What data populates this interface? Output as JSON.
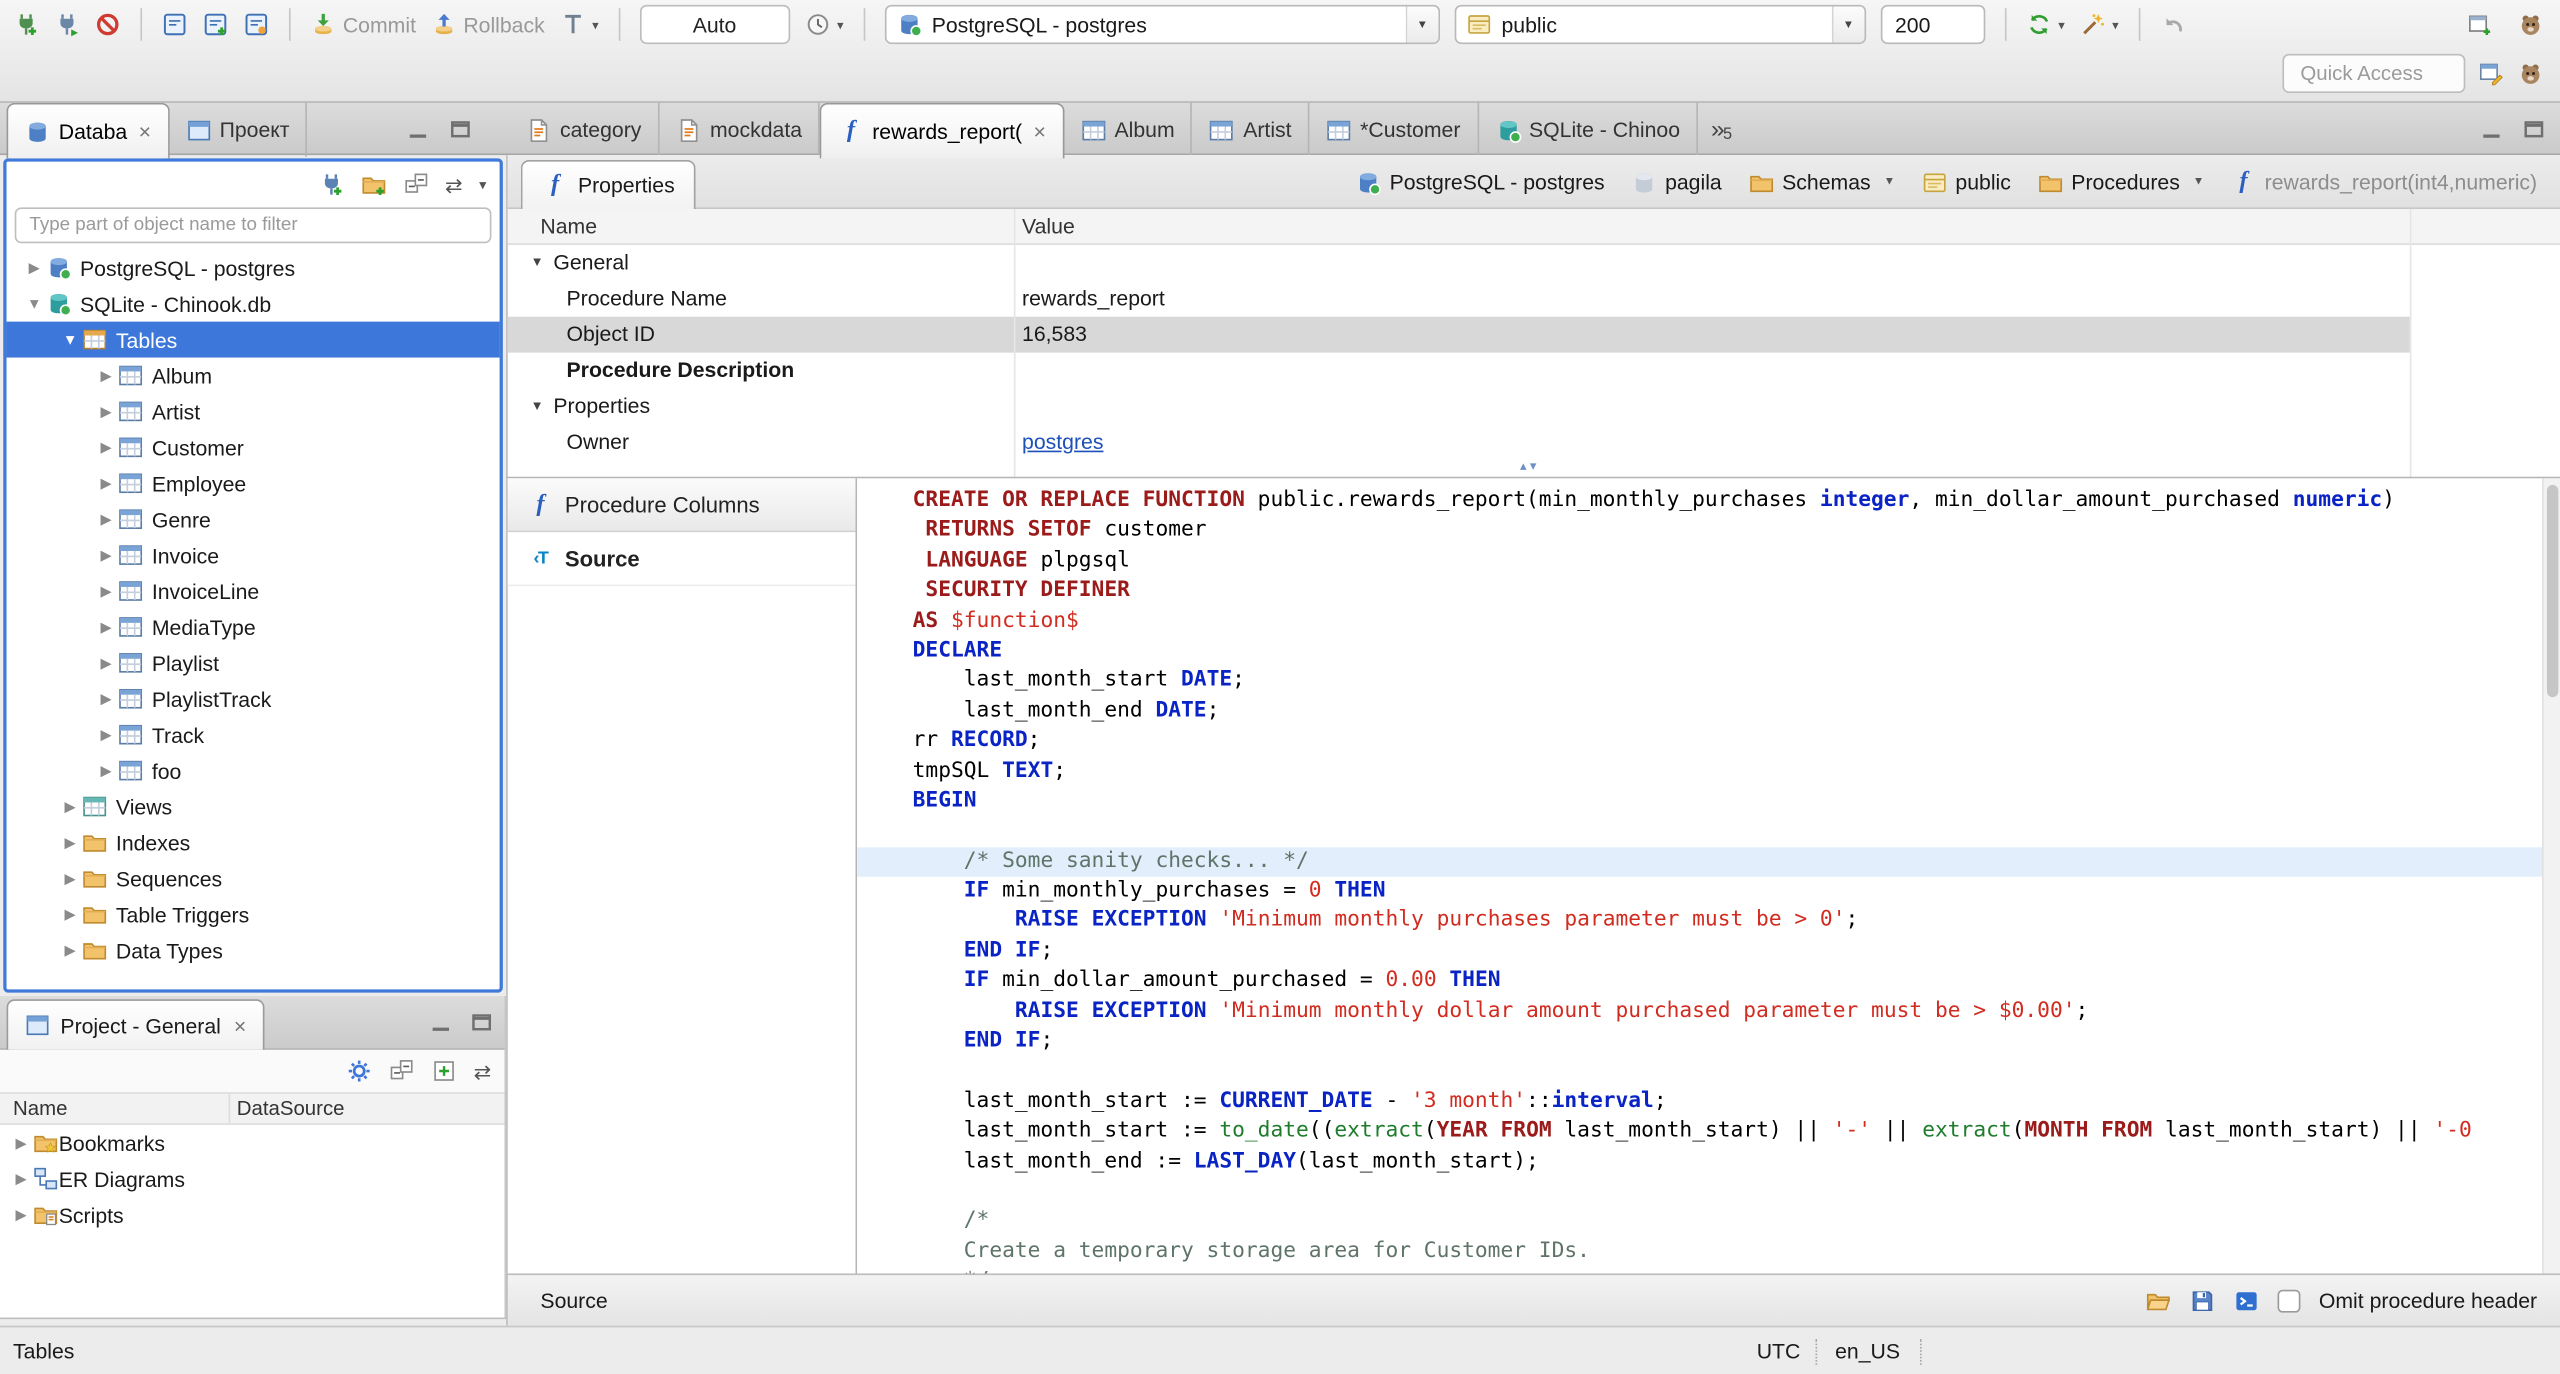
{
  "toolbar": {
    "commit": "Commit",
    "rollback": "Rollback",
    "auto_commit": "Auto",
    "connection": "PostgreSQL - postgres",
    "schema": "public",
    "fetch_size": "200",
    "quick_access": "Quick Access"
  },
  "sidebar": {
    "tabs": [
      {
        "label": "Databa",
        "icon": "db-navigator",
        "closable": true,
        "active": true
      },
      {
        "label": "Проект",
        "icon": "project-view"
      }
    ],
    "filter_placeholder": "Type part of object name to filter",
    "tree": [
      {
        "label": "PostgreSQL - postgres",
        "level": 0,
        "arrow": "right",
        "icon": "db-pg"
      },
      {
        "label": "SQLite - Chinook.db",
        "level": 0,
        "arrow": "down",
        "icon": "db-sqlite"
      },
      {
        "label": "Tables",
        "level": 1,
        "arrow": "down",
        "icon": "tables",
        "selected": true
      },
      {
        "label": "Album",
        "level": 2,
        "arrow": "right",
        "icon": "table"
      },
      {
        "label": "Artist",
        "level": 2,
        "arrow": "right",
        "icon": "table"
      },
      {
        "label": "Customer",
        "level": 2,
        "arrow": "right",
        "icon": "table"
      },
      {
        "label": "Employee",
        "level": 2,
        "arrow": "right",
        "icon": "table"
      },
      {
        "label": "Genre",
        "level": 2,
        "arrow": "right",
        "icon": "table"
      },
      {
        "label": "Invoice",
        "level": 2,
        "arrow": "right",
        "icon": "table"
      },
      {
        "label": "InvoiceLine",
        "level": 2,
        "arrow": "right",
        "icon": "table"
      },
      {
        "label": "MediaType",
        "level": 2,
        "arrow": "right",
        "icon": "table"
      },
      {
        "label": "Playlist",
        "level": 2,
        "arrow": "right",
        "icon": "table"
      },
      {
        "label": "PlaylistTrack",
        "level": 2,
        "arrow": "right",
        "icon": "table"
      },
      {
        "label": "Track",
        "level": 2,
        "arrow": "right",
        "icon": "table"
      },
      {
        "label": "foo",
        "level": 2,
        "arrow": "right",
        "icon": "table"
      },
      {
        "label": "Views",
        "level": 1,
        "arrow": "right",
        "icon": "views"
      },
      {
        "label": "Indexes",
        "level": 1,
        "arrow": "right",
        "icon": "folder"
      },
      {
        "label": "Sequences",
        "level": 1,
        "arrow": "right",
        "icon": "folder"
      },
      {
        "label": "Table Triggers",
        "level": 1,
        "arrow": "right",
        "icon": "folder"
      },
      {
        "label": "Data Types",
        "level": 1,
        "arrow": "right",
        "icon": "folder"
      }
    ]
  },
  "project": {
    "title": "Project - General",
    "columns": [
      "Name",
      "DataSource"
    ],
    "rows": [
      {
        "label": "Bookmarks",
        "icon": "bookmarks"
      },
      {
        "label": "ER Diagrams",
        "icon": "erd"
      },
      {
        "label": "Scripts",
        "icon": "scripts"
      }
    ]
  },
  "editor": {
    "tabs": [
      {
        "label": "category",
        "icon": "sql-script"
      },
      {
        "label": "mockdata",
        "icon": "sql-script"
      },
      {
        "label": "rewards_report(",
        "icon": "function",
        "active": true,
        "closable": true
      },
      {
        "label": "Album",
        "icon": "table"
      },
      {
        "label": "Artist",
        "icon": "table"
      },
      {
        "label": "*Customer",
        "icon": "table"
      },
      {
        "label": "SQLite - Chinoo",
        "icon": "db-sqlite"
      }
    ],
    "hidden_tabs_count": "5",
    "properties_tab": "Properties",
    "breadcrumb": [
      {
        "label": "PostgreSQL - postgres",
        "icon": "db-pg"
      },
      {
        "label": "pagila",
        "icon": "db-gray"
      },
      {
        "label": "Schemas",
        "icon": "folder",
        "caret": true
      },
      {
        "label": "public",
        "icon": "schema"
      },
      {
        "label": "Procedures",
        "icon": "folder",
        "caret": true
      },
      {
        "label": "rewards_report(int4,numeric)",
        "icon": "function",
        "dim": true
      }
    ],
    "grid": {
      "columns": [
        "Name",
        "Value"
      ],
      "rows": [
        {
          "name": "General",
          "group": true
        },
        {
          "name": "Procedure Name",
          "value": "rewards_report"
        },
        {
          "name": "Object ID",
          "value": "16,583",
          "selected": true
        },
        {
          "name": "Procedure Description",
          "bold": true,
          "value": ""
        },
        {
          "name": "Properties",
          "group": true
        },
        {
          "name": "Owner",
          "value": "postgres",
          "link": true
        }
      ]
    },
    "subtabs": [
      {
        "label": "Procedure Columns",
        "icon": "function"
      },
      {
        "label": "Source",
        "icon": "source",
        "active": true
      }
    ],
    "bottom": {
      "label": "Source",
      "omit_label": "Omit procedure header"
    }
  },
  "code": {
    "lines": [
      {
        "s": [
          [
            "k",
            "CREATE OR REPLACE FUNCTION"
          ],
          [
            "p",
            " public.rewards_report(min_monthly_purchases "
          ],
          [
            "b",
            "integer"
          ],
          [
            "p",
            ", min_dollar_amount_purchased "
          ],
          [
            "b",
            "numeric"
          ],
          [
            "p",
            ")"
          ]
        ]
      },
      {
        "s": [
          [
            "p",
            " "
          ],
          [
            "k",
            "RETURNS SETOF"
          ],
          [
            "p",
            " customer"
          ]
        ]
      },
      {
        "s": [
          [
            "p",
            " "
          ],
          [
            "k",
            "LANGUAGE"
          ],
          [
            "p",
            " plpgsql"
          ]
        ]
      },
      {
        "s": [
          [
            "p",
            " "
          ],
          [
            "k",
            "SECURITY DEFINER"
          ]
        ]
      },
      {
        "s": [
          [
            "k",
            "AS"
          ],
          [
            "p",
            " "
          ],
          [
            "s",
            "$function$"
          ]
        ]
      },
      {
        "s": [
          [
            "b",
            "DECLARE"
          ]
        ]
      },
      {
        "s": [
          [
            "p",
            "    last_month_start "
          ],
          [
            "b",
            "DATE"
          ],
          [
            "p",
            ";"
          ]
        ]
      },
      {
        "s": [
          [
            "p",
            "    last_month_end "
          ],
          [
            "b",
            "DATE"
          ],
          [
            "p",
            ";"
          ]
        ]
      },
      {
        "s": [
          [
            "p",
            "rr "
          ],
          [
            "b",
            "RECORD"
          ],
          [
            "p",
            ";"
          ]
        ]
      },
      {
        "s": [
          [
            "p",
            "tmpSQL "
          ],
          [
            "b",
            "TEXT"
          ],
          [
            "p",
            ";"
          ]
        ]
      },
      {
        "s": [
          [
            "b",
            "BEGIN"
          ]
        ]
      },
      {
        "s": []
      },
      {
        "hl": true,
        "s": [
          [
            "p",
            "    "
          ],
          [
            "c",
            "/* Some sanity checks... */"
          ]
        ]
      },
      {
        "s": [
          [
            "p",
            "    "
          ],
          [
            "b",
            "IF"
          ],
          [
            "p",
            " min_monthly_purchases = "
          ],
          [
            "n",
            "0"
          ],
          [
            "p",
            " "
          ],
          [
            "b",
            "THEN"
          ]
        ]
      },
      {
        "s": [
          [
            "p",
            "        "
          ],
          [
            "b",
            "RAISE EXCEPTION"
          ],
          [
            "p",
            " "
          ],
          [
            "s",
            "'Minimum monthly purchases parameter must be > 0'"
          ],
          [
            "p",
            ";"
          ]
        ]
      },
      {
        "s": [
          [
            "p",
            "    "
          ],
          [
            "b",
            "END IF"
          ],
          [
            "p",
            ";"
          ]
        ]
      },
      {
        "s": [
          [
            "p",
            "    "
          ],
          [
            "b",
            "IF"
          ],
          [
            "p",
            " min_dollar_amount_purchased = "
          ],
          [
            "n",
            "0.00"
          ],
          [
            "p",
            " "
          ],
          [
            "b",
            "THEN"
          ]
        ]
      },
      {
        "s": [
          [
            "p",
            "        "
          ],
          [
            "b",
            "RAISE EXCEPTION"
          ],
          [
            "p",
            " "
          ],
          [
            "s",
            "'Minimum monthly dollar amount purchased parameter must be > $0.00'"
          ],
          [
            "p",
            ";"
          ]
        ]
      },
      {
        "s": [
          [
            "p",
            "    "
          ],
          [
            "b",
            "END IF"
          ],
          [
            "p",
            ";"
          ]
        ]
      },
      {
        "s": []
      },
      {
        "s": [
          [
            "p",
            "    last_month_start := "
          ],
          [
            "b",
            "CURRENT_DATE"
          ],
          [
            "p",
            " - "
          ],
          [
            "s",
            "'3 month'"
          ],
          [
            "p",
            "::"
          ],
          [
            "b",
            "interval"
          ],
          [
            "p",
            ";"
          ]
        ]
      },
      {
        "s": [
          [
            "p",
            "    last_month_start := "
          ],
          [
            "f",
            "to_date"
          ],
          [
            "p",
            "(("
          ],
          [
            "f",
            "extract"
          ],
          [
            "p",
            "("
          ],
          [
            "k",
            "YEAR"
          ],
          [
            "p",
            " "
          ],
          [
            "k",
            "FROM"
          ],
          [
            "p",
            " last_month_start) || "
          ],
          [
            "s",
            "'-'"
          ],
          [
            "p",
            " || "
          ],
          [
            "f",
            "extract"
          ],
          [
            "p",
            "("
          ],
          [
            "k",
            "MONTH"
          ],
          [
            "p",
            " "
          ],
          [
            "k",
            "FROM"
          ],
          [
            "p",
            " last_month_start) || "
          ],
          [
            "s",
            "'-0"
          ]
        ]
      },
      {
        "s": [
          [
            "p",
            "    last_month_end := "
          ],
          [
            "b",
            "LAST_DAY"
          ],
          [
            "p",
            "(last_month_start);"
          ]
        ]
      },
      {
        "s": []
      },
      {
        "s": [
          [
            "p",
            "    "
          ],
          [
            "c",
            "/*"
          ]
        ]
      },
      {
        "s": [
          [
            "p",
            "    "
          ],
          [
            "c",
            "Create a temporary storage area for Customer IDs."
          ]
        ]
      },
      {
        "s": [
          [
            "p",
            "    "
          ],
          [
            "c",
            "*/"
          ]
        ]
      }
    ]
  },
  "statusbar": {
    "left": "Tables",
    "timezone": "UTC",
    "locale": "en_US"
  }
}
